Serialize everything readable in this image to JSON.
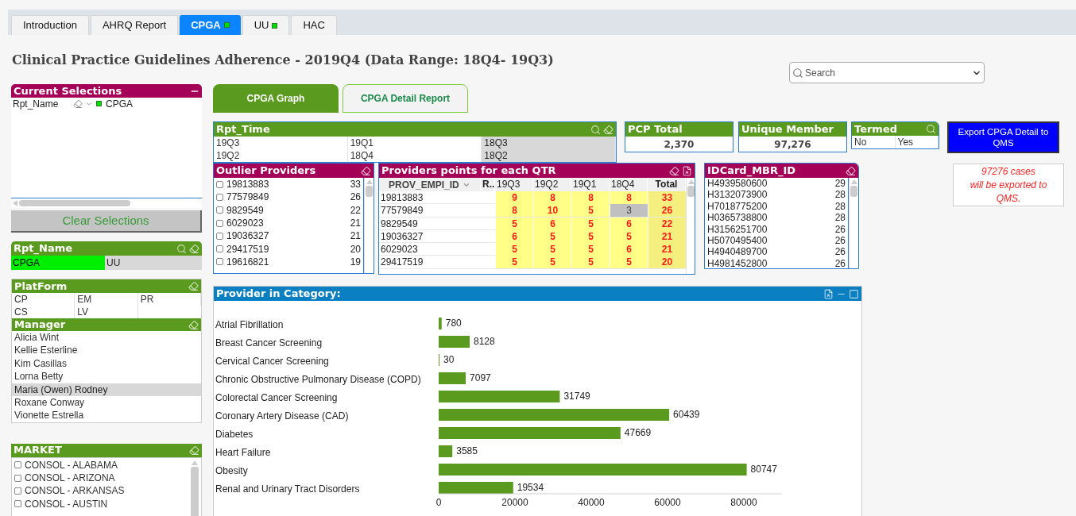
{
  "tabs": [
    {
      "label": "Introduction",
      "selected": false,
      "indicator": false
    },
    {
      "label": "AHRQ Report",
      "selected": false,
      "indicator": false
    },
    {
      "label": "CPGA",
      "selected": true,
      "indicator": true
    },
    {
      "label": "UU",
      "selected": false,
      "indicator": true
    },
    {
      "label": "HAC",
      "selected": false,
      "indicator": false
    }
  ],
  "title": "Clinical Practice Guidelines Adherence - 2019Q4 (Data Range: 18Q4- 19Q3)",
  "search": {
    "placeholder": "Search"
  },
  "current_selections": {
    "title": "Current Selections",
    "rows": [
      {
        "field": "Rpt_Name",
        "value": "CPGA"
      }
    ]
  },
  "clear_button": "Clear Selections",
  "rpt_name": {
    "title": "Rpt_Name",
    "items": [
      {
        "label": "CPGA",
        "selected": true,
        "excluded": false
      },
      {
        "label": "UU",
        "selected": false,
        "excluded": true
      }
    ]
  },
  "platform": {
    "title": "PlatForm",
    "items": [
      {
        "label": "CP",
        "selected": false,
        "excluded": false
      },
      {
        "label": "EM",
        "selected": false,
        "excluded": false
      },
      {
        "label": "PR",
        "selected": false,
        "excluded": false
      },
      {
        "label": "CS",
        "selected": false,
        "excluded": false
      },
      {
        "label": "LV",
        "selected": false,
        "excluded": false
      }
    ]
  },
  "manager": {
    "title": "Manager",
    "items": [
      {
        "label": "Alicia Wint",
        "selected": false,
        "excluded": false
      },
      {
        "label": "Kellie Esterline",
        "selected": false,
        "excluded": false
      },
      {
        "label": "Kim Casillas",
        "selected": false,
        "excluded": false
      },
      {
        "label": "Lorna Betty",
        "selected": false,
        "excluded": false
      },
      {
        "label": "Maria (Owen) Rodney",
        "selected": false,
        "excluded": true
      },
      {
        "label": "Roxane Conway",
        "selected": false,
        "excluded": false
      },
      {
        "label": "Vionette Estrella",
        "selected": false,
        "excluded": false
      }
    ]
  },
  "market": {
    "title": "MARKET",
    "items": [
      {
        "label": "CONSOL - ALABAMA",
        "checked": false
      },
      {
        "label": "CONSOL - ARIZONA",
        "checked": false
      },
      {
        "label": "CONSOL - ARKANSAS",
        "checked": false
      },
      {
        "label": "CONSOL - AUSTIN",
        "checked": false
      }
    ]
  },
  "sheet_buttons": [
    {
      "label": "CPGA Graph",
      "selected": true
    },
    {
      "label": "CPGA Detail Report",
      "selected": false
    }
  ],
  "rpt_time": {
    "title": "Rpt_Time",
    "items": [
      {
        "label": "19Q3",
        "selected": false,
        "excluded": false
      },
      {
        "label": "19Q1",
        "selected": false,
        "excluded": false
      },
      {
        "label": "18Q3",
        "selected": false,
        "excluded": true
      },
      {
        "label": "19Q2",
        "selected": false,
        "excluded": false
      },
      {
        "label": "18Q4",
        "selected": false,
        "excluded": false
      },
      {
        "label": "18Q2",
        "selected": false,
        "excluded": true
      }
    ]
  },
  "pcp_total": {
    "title": "PCP Total",
    "value": "2,370"
  },
  "unique_member": {
    "title": "Unique Member",
    "value": "97,276"
  },
  "termed": {
    "title": "Termed",
    "items": [
      {
        "label": "No",
        "selected": false,
        "excluded": false
      },
      {
        "label": "Yes",
        "selected": false,
        "excluded": false
      }
    ]
  },
  "export_button": "Export CPGA Detail to QMS",
  "export_note": [
    "97276 cases",
    "will be exported to",
    "QMS."
  ],
  "outlier_providers": {
    "title": "Outlier Providers",
    "items": [
      {
        "id": "19813883",
        "count": "33",
        "checked": false
      },
      {
        "id": "77579849",
        "count": "26",
        "checked": false
      },
      {
        "id": "9829549",
        "count": "22",
        "checked": false
      },
      {
        "id": "6029023",
        "count": "21",
        "checked": false
      },
      {
        "id": "19036327",
        "count": "21",
        "checked": false
      },
      {
        "id": "29417519",
        "count": "20",
        "checked": false
      },
      {
        "id": "19616821",
        "count": "19",
        "checked": false
      }
    ]
  },
  "points_table": {
    "title": "Providers points for each QTR",
    "columns": [
      {
        "label": "PROV_EMPI_ID",
        "kind": "id"
      },
      {
        "label": "R..",
        "kind": "rank"
      },
      {
        "label": "19Q3",
        "kind": "quarter"
      },
      {
        "label": "19Q2",
        "kind": "quarter"
      },
      {
        "label": "19Q1",
        "kind": "quarter"
      },
      {
        "label": "18Q4",
        "kind": "quarter"
      },
      {
        "label": "Total",
        "kind": "total"
      }
    ],
    "rows": [
      {
        "id": "19813883",
        "quarters": [
          {
            "value": "9",
            "shaded": false
          },
          {
            "value": "8",
            "shaded": false
          },
          {
            "value": "8",
            "shaded": false
          },
          {
            "value": "8",
            "shaded": false
          }
        ],
        "total": "33"
      },
      {
        "id": "77579849",
        "quarters": [
          {
            "value": "8",
            "shaded": false
          },
          {
            "value": "10",
            "shaded": false
          },
          {
            "value": "5",
            "shaded": false
          },
          {
            "value": "3",
            "shaded": true
          }
        ],
        "total": "26"
      },
      {
        "id": "9829549",
        "quarters": [
          {
            "value": "5",
            "shaded": false
          },
          {
            "value": "6",
            "shaded": false
          },
          {
            "value": "5",
            "shaded": false
          },
          {
            "value": "6",
            "shaded": false
          }
        ],
        "total": "22"
      },
      {
        "id": "19036327",
        "quarters": [
          {
            "value": "6",
            "shaded": false
          },
          {
            "value": "5",
            "shaded": false
          },
          {
            "value": "5",
            "shaded": false
          },
          {
            "value": "5",
            "shaded": false
          }
        ],
        "total": "21"
      },
      {
        "id": "6029023",
        "quarters": [
          {
            "value": "5",
            "shaded": false
          },
          {
            "value": "5",
            "shaded": false
          },
          {
            "value": "5",
            "shaded": false
          },
          {
            "value": "6",
            "shaded": false
          }
        ],
        "total": "21"
      },
      {
        "id": "29417519",
        "quarters": [
          {
            "value": "5",
            "shaded": false
          },
          {
            "value": "5",
            "shaded": false
          },
          {
            "value": "5",
            "shaded": false
          },
          {
            "value": "5",
            "shaded": false
          }
        ],
        "total": "20"
      }
    ]
  },
  "idcard": {
    "title": "IDCard_MBR_ID",
    "items": [
      {
        "id": "H4939580600",
        "count": "29"
      },
      {
        "id": "H3132073900",
        "count": "28"
      },
      {
        "id": "H7018775200",
        "count": "28"
      },
      {
        "id": "H0365738800",
        "count": "28"
      },
      {
        "id": "H3156251700",
        "count": "26"
      },
      {
        "id": "H5070495400",
        "count": "26"
      },
      {
        "id": "H4940489700",
        "count": "26"
      },
      {
        "id": "H4981452800",
        "count": "26"
      }
    ]
  },
  "chart": {
    "title": "Provider in Category:",
    "chart_data": {
      "type": "bar",
      "orientation": "horizontal",
      "data_labels": true,
      "categories": [
        "Atrial Fibrillation",
        "Breast Cancer Screening",
        "Cervical Cancer Screening",
        "Chronic Obstructive Pulmonary Disease (COPD)",
        "Colorectal Cancer Screening",
        "Coronary Artery Disease (CAD)",
        "Diabetes",
        "Heart Failure",
        "Obesity",
        "Renal and Urinary Tract Disorders"
      ],
      "series": [
        {
          "color": "#5a9a1e",
          "values": [
            780,
            8128,
            30,
            7097,
            31749,
            60439,
            47669,
            3585,
            80747,
            19534
          ]
        }
      ],
      "xlim": [
        0,
        90000
      ],
      "xticks": [
        0,
        20000,
        40000,
        60000,
        80000
      ]
    }
  }
}
